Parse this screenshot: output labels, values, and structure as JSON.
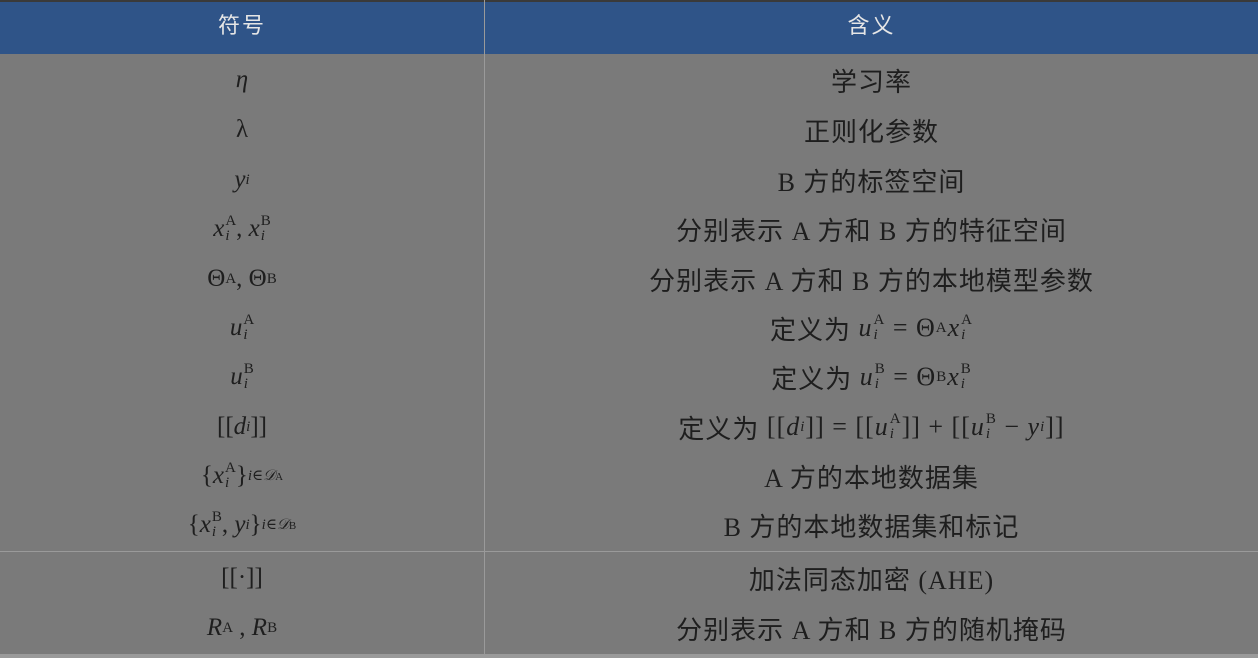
{
  "header": {
    "col_symbol": "符号",
    "col_meaning": "含义"
  },
  "rows": [
    {
      "meaning": "学习率"
    },
    {
      "meaning": "正则化参数"
    },
    {
      "meaning": "B 方的标签空间"
    },
    {
      "meaning": "分别表示 A 方和 B 方的特征空间"
    },
    {
      "meaning": "分别表示 A 方和 B 方的本地模型参数"
    },
    {
      "meaning_prefix": "定义为"
    },
    {
      "meaning_prefix": "定义为"
    },
    {
      "meaning_prefix": "定义为"
    },
    {
      "meaning": "A 方的本地数据集"
    },
    {
      "meaning": "B 方的本地数据集和标记"
    },
    {
      "meaning": "加法同态加密 (AHE)"
    },
    {
      "meaning": "分别表示 A 方和 B 方的随机掩码"
    }
  ]
}
